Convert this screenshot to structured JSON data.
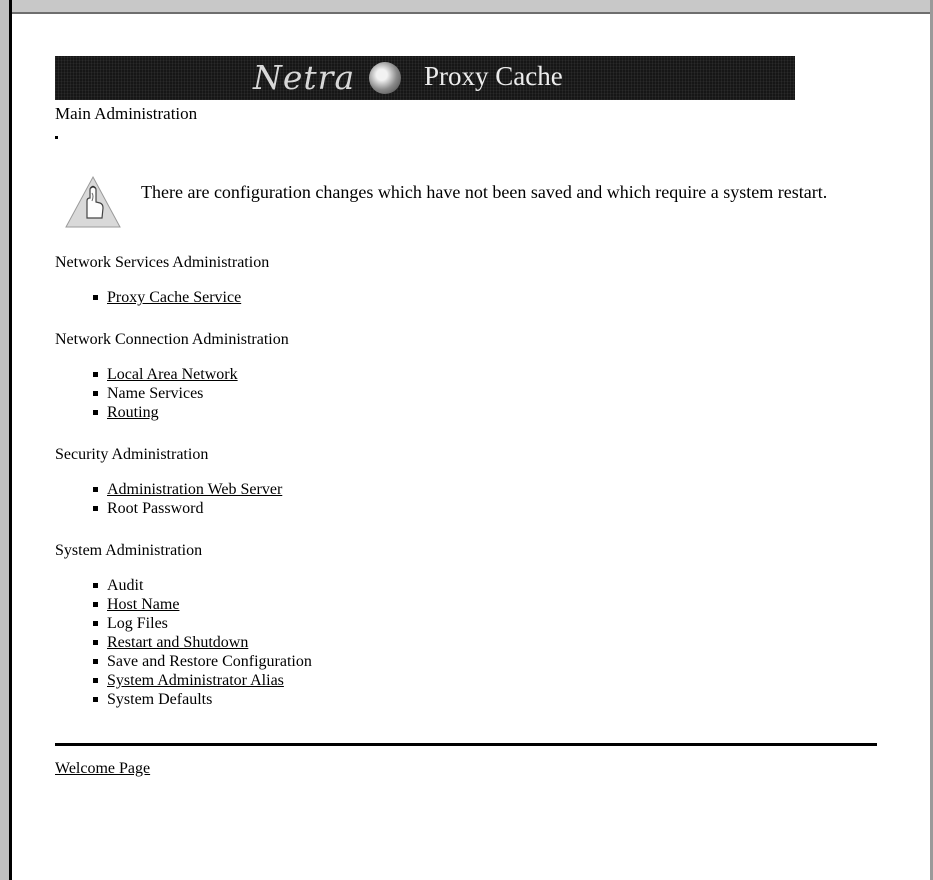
{
  "banner": {
    "brand": "Netra",
    "product": "Proxy Cache"
  },
  "page": {
    "subtitle": "Main Administration"
  },
  "notice": {
    "text": "There are configuration changes which have not been saved and which require a system restart."
  },
  "sections": [
    {
      "heading": "Network Services Administration",
      "items": [
        {
          "label": "Proxy Cache Service",
          "link": true
        }
      ]
    },
    {
      "heading": "Network Connection Administration",
      "items": [
        {
          "label": "Local Area Network",
          "link": true
        },
        {
          "label": "Name Services",
          "link": false
        },
        {
          "label": "Routing",
          "link": true
        }
      ]
    },
    {
      "heading": "Security Administration",
      "items": [
        {
          "label": "Administration Web Server",
          "link": true
        },
        {
          "label": "Root Password",
          "link": false
        }
      ]
    },
    {
      "heading": "System Administration",
      "items": [
        {
          "label": "Audit",
          "link": false
        },
        {
          "label": "Host Name",
          "link": true
        },
        {
          "label": "Log Files",
          "link": false
        },
        {
          "label": "Restart and Shutdown",
          "link": true
        },
        {
          "label": "Save and Restore Configuration",
          "link": false
        },
        {
          "label": "System Administrator Alias",
          "link": true
        },
        {
          "label": "System Defaults",
          "link": false
        }
      ]
    }
  ],
  "footer": {
    "link_label": "Welcome Page"
  },
  "icons": {
    "warning": "hand-warning-icon",
    "brand": "globe-logo-icon"
  }
}
